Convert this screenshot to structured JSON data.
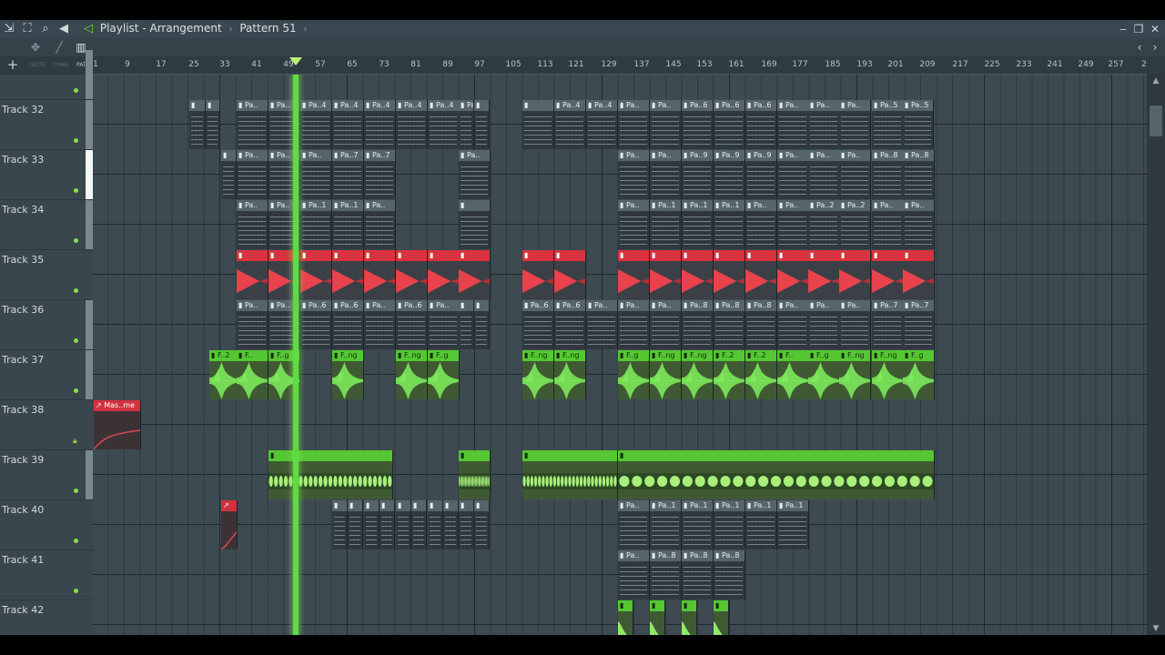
{
  "window": {
    "title_parts": [
      "Playlist",
      "Arrangement",
      "Pattern 51"
    ],
    "title_separators": [
      "-",
      "›",
      "›"
    ],
    "controls": {
      "minimize": "‒",
      "maximize": "❐",
      "close": "✕"
    }
  },
  "toolbar": {
    "modes": [
      "NOTE",
      "CHAN",
      "PAT"
    ],
    "active_mode": "PAT",
    "add_track_symbol": "+"
  },
  "ruler": {
    "ticks": [
      "1",
      "9",
      "17",
      "25",
      "33",
      "41",
      "49",
      "57",
      "65",
      "73",
      "81",
      "89",
      "97",
      "105",
      "113",
      "121",
      "129",
      "137",
      "145",
      "153",
      "161",
      "169",
      "177",
      "185",
      "193",
      "201",
      "209",
      "217",
      "225",
      "233",
      "241",
      "249",
      "257",
      "2"
    ],
    "playhead_bar": 49
  },
  "tracks": [
    {
      "name": "Track 32"
    },
    {
      "name": "Track 33"
    },
    {
      "name": "Track 34"
    },
    {
      "name": "Track 35"
    },
    {
      "name": "Track 36"
    },
    {
      "name": "Track 37"
    },
    {
      "name": "Track 38"
    },
    {
      "name": "Track 39"
    },
    {
      "name": "Track 40"
    },
    {
      "name": "Track 41"
    },
    {
      "name": "Track 42"
    }
  ],
  "clips": {
    "track32": [
      "",
      "",
      "Pa..",
      "Pa..",
      "Pa..4",
      "Pa..4",
      "Pa..4",
      "Pa..4",
      "Pa..4",
      "Pa..",
      "",
      "",
      "Pa..4",
      "Pa..4",
      "Pa..",
      "Pa..",
      "Pa..6",
      "Pa..6",
      "Pa..6",
      "Pa..",
      "Pa..",
      "Pa..",
      "Pa..5",
      "Pa..5",
      "Pa.."
    ],
    "track33": [
      "",
      "Pa..",
      "Pa..",
      "Pa..",
      "Pa..7",
      "Pa..7",
      "Pa..",
      "",
      "",
      "Pa..",
      "Pa..",
      "Pa..9",
      "Pa..9",
      "Pa..9",
      "Pa..",
      "Pa..",
      "Pa..",
      "Pa..8",
      "Pa..8",
      "Pa.."
    ],
    "track34": [
      "Pa..",
      "Pa..",
      "Pa..1",
      "Pa..1",
      "Pa..",
      "",
      "Pa..",
      "Pa..1",
      "Pa..1",
      "Pa..1",
      "Pa..",
      "Pa..",
      "Pa..2",
      "Pa..2",
      "Pa.."
    ],
    "track36": [
      "Pa..",
      "Pa..",
      "Pa..6",
      "Pa..6",
      "Pa..",
      "Pa..6",
      "Pa..",
      "",
      "",
      "Pa..6",
      "Pa..6",
      "Pa..",
      "Pa..",
      "Pa..",
      "Pa..8",
      "Pa..8",
      "Pa..8",
      "Pa..",
      "Pa..",
      "Pa..",
      "Pa..7",
      "Pa..7",
      "Pa.."
    ],
    "track37": [
      "F..2",
      "F..",
      "F..g",
      "F..ng",
      "F..ng",
      "F..g",
      "F..ng",
      "F..ng",
      "F..g",
      "F..ng",
      "F..ng",
      "F..2",
      "F..2",
      "F..",
      "F..g",
      "F..ng",
      "F..ng",
      "F..g"
    ],
    "track38": "Mas..me",
    "track40": [
      "",
      "",
      "",
      "",
      "",
      "",
      "",
      "",
      "",
      "",
      "Pa..",
      "Pa..1",
      "Pa..1",
      "Pa..1",
      "Pa..1",
      "Pa..1"
    ],
    "track41": [
      "Pa..",
      "Pa..8",
      "Pa..8"
    ]
  },
  "colors": {
    "pattern_header": "#56646b",
    "red_clip": "#d8333e",
    "green_clip": "#55c733",
    "playhead": "#5ddc43",
    "background": "#3d4a51"
  },
  "icons": [
    "snap-icon",
    "slice-icon",
    "zoom-icon",
    "speaker-icon",
    "play-icon",
    "close-icon",
    "lock-icon",
    "add-icon"
  ]
}
